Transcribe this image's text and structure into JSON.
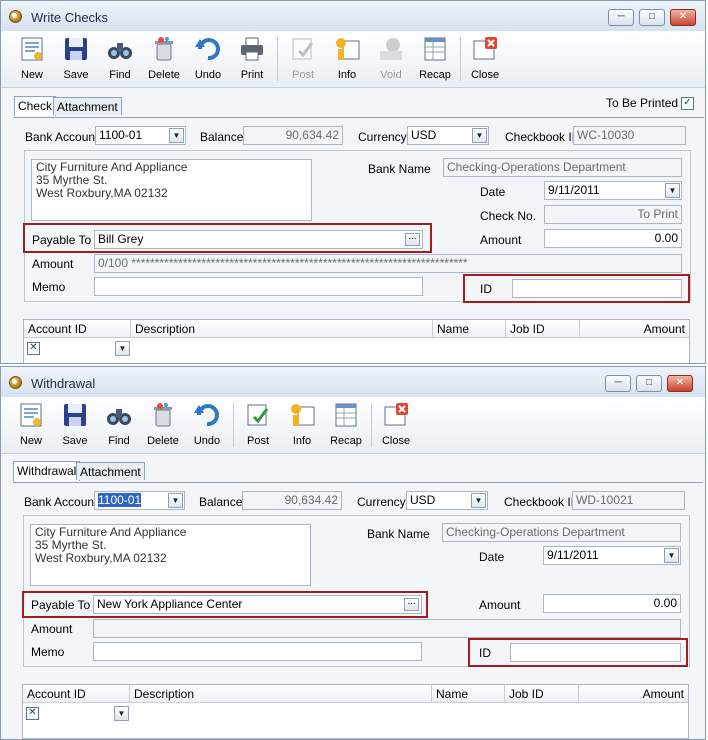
{
  "check_window": {
    "title": "Write Checks",
    "toolbar": [
      {
        "label": "New",
        "icon": "new-document-icon",
        "disabled": false
      },
      {
        "label": "Save",
        "icon": "floppy-disk-icon",
        "disabled": false
      },
      {
        "label": "Find",
        "icon": "binoculars-icon",
        "disabled": false
      },
      {
        "label": "Delete",
        "icon": "trash-bin-icon",
        "disabled": false
      },
      {
        "label": "Undo",
        "icon": "undo-arrow-icon",
        "disabled": false
      },
      {
        "label": "Print",
        "icon": "printer-icon",
        "disabled": false
      },
      {
        "label": "Post",
        "icon": "post-ledger-icon",
        "disabled": true
      },
      {
        "label": "Info",
        "icon": "info-icon",
        "disabled": false
      },
      {
        "label": "Void",
        "icon": "void-icon",
        "disabled": true
      },
      {
        "label": "Recap",
        "icon": "recap-icon",
        "disabled": false
      },
      {
        "label": "Close",
        "icon": "close-form-icon",
        "disabled": false
      }
    ],
    "tabs": [
      "Check",
      "Attachment"
    ],
    "to_be_printed_label": "To Be Printed",
    "to_be_printed_checked": true,
    "bank_account_label": "Bank Account",
    "bank_account_value": "1100-01",
    "balance_label": "Balance",
    "balance_value": "90,634.42",
    "currency_label": "Currency",
    "currency_value": "USD",
    "checkbook_label": "Checkbook ID",
    "checkbook_value": "WC-10030",
    "address": [
      "City Furniture And Appliance",
      "35 Myrthe St.",
      "West Roxbury,MA 02132"
    ],
    "bank_name_label": "Bank Name",
    "bank_name_value": "Checking-Operations Department",
    "date_label": "Date",
    "date_value": "9/11/2011",
    "check_no_label": "Check No.",
    "check_no_value": "To Print",
    "payable_label": "Payable To",
    "payable_value": "Bill Grey",
    "amount_label": "Amount",
    "amount_value": "0.00",
    "amount_words_label": "Amount",
    "amount_words_value": "0/100 ************************************************************************",
    "memo_label": "Memo",
    "id_label": "ID",
    "grid_headers": [
      "Account ID",
      "Description",
      "Name",
      "Job ID",
      "Amount"
    ]
  },
  "withdrawal_window": {
    "title": "Withdrawal",
    "toolbar": [
      {
        "label": "New",
        "icon": "new-document-icon",
        "disabled": false
      },
      {
        "label": "Save",
        "icon": "floppy-disk-icon",
        "disabled": false
      },
      {
        "label": "Find",
        "icon": "binoculars-icon",
        "disabled": false
      },
      {
        "label": "Delete",
        "icon": "trash-bin-icon",
        "disabled": false
      },
      {
        "label": "Undo",
        "icon": "undo-arrow-icon",
        "disabled": false
      },
      {
        "label": "Post",
        "icon": "post-ledger-icon",
        "disabled": false
      },
      {
        "label": "Info",
        "icon": "info-icon",
        "disabled": false
      },
      {
        "label": "Recap",
        "icon": "recap-icon",
        "disabled": false
      },
      {
        "label": "Close",
        "icon": "close-form-icon",
        "disabled": false
      }
    ],
    "tabs": [
      "Withdrawal",
      "Attachment"
    ],
    "bank_account_label": "Bank Account",
    "bank_account_value": "1100-01",
    "balance_label": "Balance",
    "balance_value": "90,634.42",
    "currency_label": "Currency",
    "currency_value": "USD",
    "checkbook_label": "Checkbook ID",
    "checkbook_value": "WD-10021",
    "address": [
      "City Furniture And Appliance",
      "35 Myrthe St.",
      "West Roxbury,MA 02132"
    ],
    "bank_name_label": "Bank Name",
    "bank_name_value": "Checking-Operations Department",
    "date_label": "Date",
    "date_value": "9/11/2011",
    "payable_label": "Payable To",
    "payable_value": "New York Appliance Center",
    "amount_label": "Amount",
    "amount_value": "0.00",
    "amount_words_label": "Amount",
    "memo_label": "Memo",
    "id_label": "ID",
    "grid_headers": [
      "Account ID",
      "Description",
      "Name",
      "Job ID",
      "Amount"
    ]
  },
  "colors": {
    "highlight_box": "#a31d1d",
    "selection": "#3166c5"
  }
}
